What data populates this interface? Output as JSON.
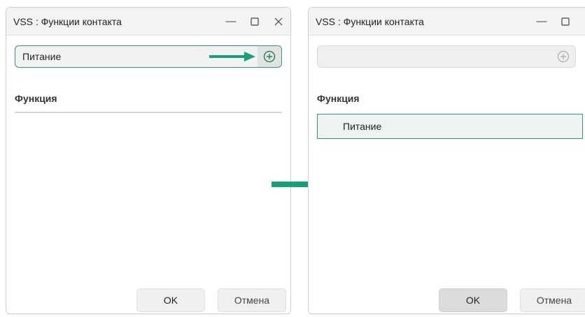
{
  "left_window": {
    "title": "VSS : Функции контакта",
    "input_value": "Питание",
    "section_header": "Функция",
    "ok_label": "OK",
    "cancel_label": "Отмена"
  },
  "right_window": {
    "title": "VSS : Функции контакта",
    "input_value": "",
    "section_header": "Функция",
    "function_rows": [
      "Питание"
    ],
    "ok_label": "OK",
    "cancel_label": "Отмена"
  },
  "icons": {
    "minimize": "minimize-icon",
    "maximize": "maximize-icon",
    "close": "close-icon",
    "add": "plus-circle-icon",
    "arrow": "arrow-right-icon"
  },
  "colors": {
    "accent": "#1a9e7a",
    "focus_border": "#3a8f7e"
  }
}
